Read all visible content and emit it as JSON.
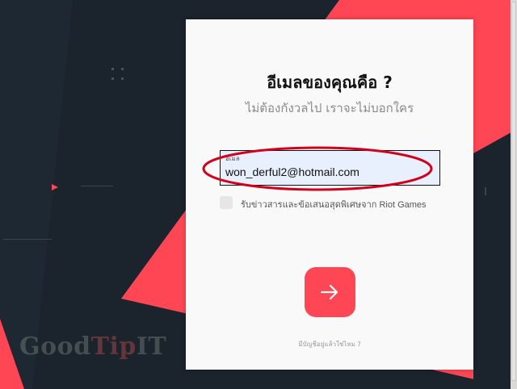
{
  "colors": {
    "brand_red": "#ff4655",
    "background_dark": "#1a222c",
    "card_bg": "#f9f9f9",
    "annotation_red": "#d0021b"
  },
  "form": {
    "title": "อีเมลของคุณคือ ?",
    "subtitle": "ไม่ต้องกังวลไป เราจะไม่บอกใคร",
    "email_label": "อีเมล",
    "email_value": "won_derful2@hotmail.com",
    "checkbox_label": "รับข่าวสารและข้อเสนอสุดพิเศษจาก Riot Games",
    "checkbox_checked": false,
    "next_icon": "arrow-right-icon",
    "account_link": "มีบัญชีอยู่แล้วใช่ไหม ?"
  },
  "watermark": {
    "part1": "Good",
    "part2": "Tip",
    "part3": "IT"
  }
}
